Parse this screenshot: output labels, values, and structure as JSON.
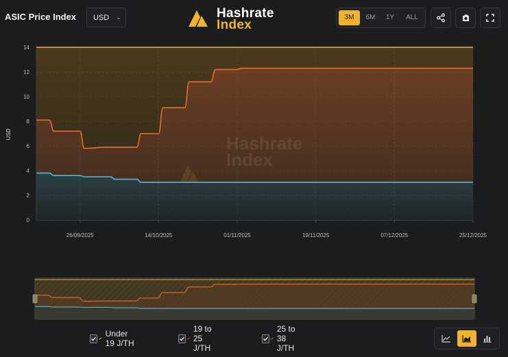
{
  "header": {
    "title": "ASIC Price Index",
    "currency": "USD",
    "logo_line1": "Hashrate",
    "logo_line2": "Index",
    "ranges": [
      "3M",
      "6M",
      "1Y",
      "ALL"
    ],
    "active_range": "3M",
    "tools": [
      "share-icon",
      "screenshot-icon",
      "fullscreen-icon"
    ]
  },
  "watermark": {
    "line1": "Hashrate",
    "line2": "Index"
  },
  "colors": {
    "accent": "#f0b42a",
    "under19": "#e8b23a",
    "mid": "#f06a2a",
    "high": "#55b8d4",
    "background": "#1b1c1e"
  },
  "chart_data": {
    "type": "area",
    "ylabel": "USD",
    "ylim": [
      0,
      14
    ],
    "yticks": [
      0,
      2,
      4,
      6,
      8,
      10,
      12,
      14
    ],
    "x_range": [
      "2025-09-16",
      "2025-12-25"
    ],
    "xticks": [
      "26/09/2025",
      "14/10/2025",
      "01/11/2025",
      "19/11/2025",
      "07/12/2025",
      "25/12/2025"
    ],
    "grid": true,
    "legend_position": "bottom",
    "series": [
      {
        "name": "Under 19 J/TH",
        "color": "#e8b23a",
        "points": [
          [
            "2025-09-16",
            14.0
          ],
          [
            "2025-12-25",
            14.0
          ]
        ]
      },
      {
        "name": "19 to 25 J/TH",
        "color": "#f06a2a",
        "points": [
          [
            "2025-09-16",
            8.1
          ],
          [
            "2025-09-19",
            8.1
          ],
          [
            "2025-09-20",
            7.2
          ],
          [
            "2025-09-26",
            7.2
          ],
          [
            "2025-09-27",
            5.8
          ],
          [
            "2025-10-02",
            5.9
          ],
          [
            "2025-10-09",
            5.9
          ],
          [
            "2025-10-10",
            7.0
          ],
          [
            "2025-10-14",
            7.0
          ],
          [
            "2025-10-15",
            9.1
          ],
          [
            "2025-10-20",
            9.1
          ],
          [
            "2025-10-21",
            11.2
          ],
          [
            "2025-10-26",
            11.2
          ],
          [
            "2025-10-27",
            12.2
          ],
          [
            "2025-11-01",
            12.2
          ],
          [
            "2025-11-02",
            12.3
          ],
          [
            "2025-12-25",
            12.3
          ]
        ]
      },
      {
        "name": "25 to 38 J/TH",
        "color": "#55b8d4",
        "points": [
          [
            "2025-09-16",
            3.8
          ],
          [
            "2025-09-19",
            3.8
          ],
          [
            "2025-09-20",
            3.6
          ],
          [
            "2025-09-26",
            3.6
          ],
          [
            "2025-09-27",
            3.5
          ],
          [
            "2025-10-03",
            3.5
          ],
          [
            "2025-10-04",
            3.3
          ],
          [
            "2025-10-09",
            3.3
          ],
          [
            "2025-10-10",
            3.05
          ],
          [
            "2025-12-25",
            3.05
          ]
        ]
      }
    ]
  },
  "legend": [
    {
      "label": "Under 19 J/TH",
      "checked": true,
      "color": "#e8b23a"
    },
    {
      "label": "19 to 25 J/TH",
      "checked": true,
      "color": "#f06a2a"
    },
    {
      "label": "25 to 38 J/TH",
      "checked": true,
      "color": "#55b8d4"
    }
  ],
  "chart_types": [
    "line-chart-icon",
    "area-chart-icon",
    "bar-chart-icon"
  ],
  "active_chart_type": "area-chart-icon"
}
